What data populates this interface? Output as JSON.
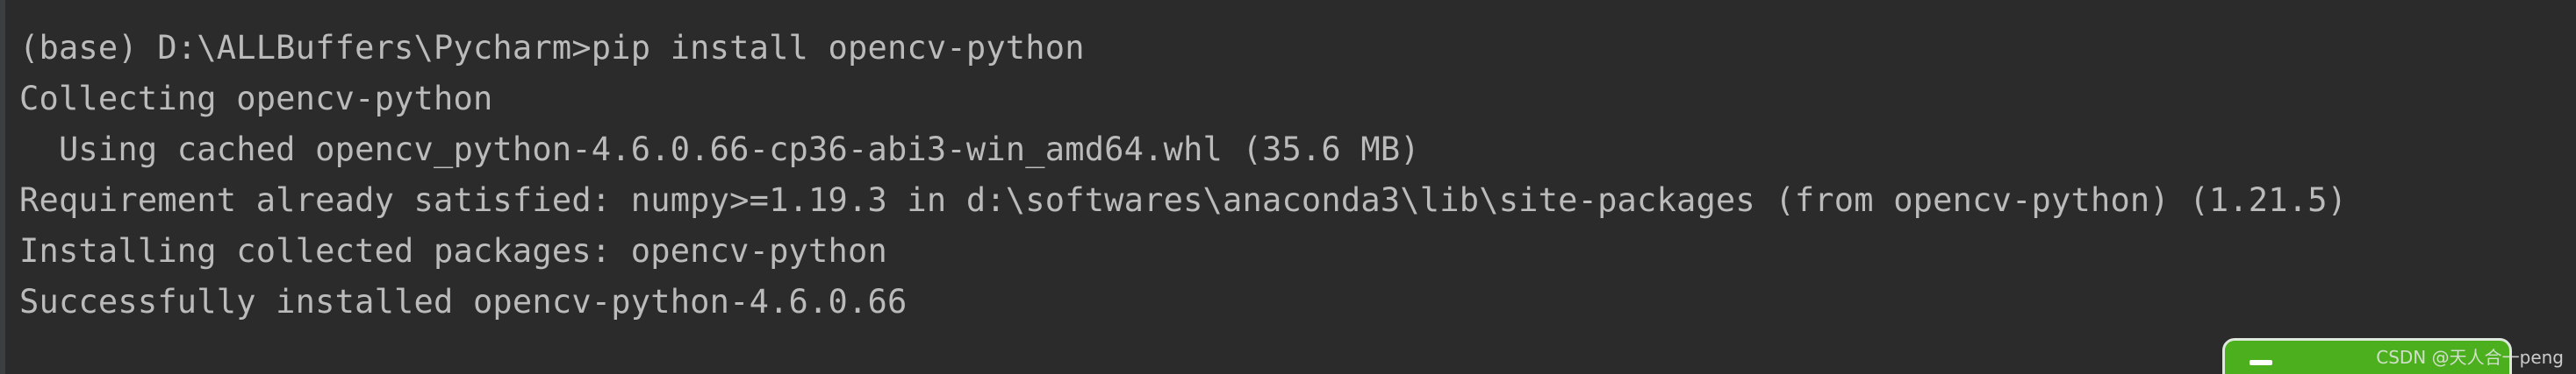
{
  "terminal": {
    "lines": [
      "(base) D:\\ALLBuffers\\Pycharm>pip install opencv-python",
      "Collecting opencv-python",
      "  Using cached opencv_python-4.6.0.66-cp36-abi3-win_amd64.whl (35.6 MB)",
      "Requirement already satisfied: numpy>=1.19.3 in d:\\softwares\\anaconda3\\lib\\site-packages (from opencv-python) (1.21.5)",
      "Installing collected packages: opencv-python",
      "Successfully installed opencv-python-4.6.0.66"
    ]
  },
  "watermark": {
    "text": "CSDN @天人合一peng"
  },
  "colors": {
    "background": "#2b2b2b",
    "text": "#bbbbbb",
    "badge": "#4caf1e"
  }
}
